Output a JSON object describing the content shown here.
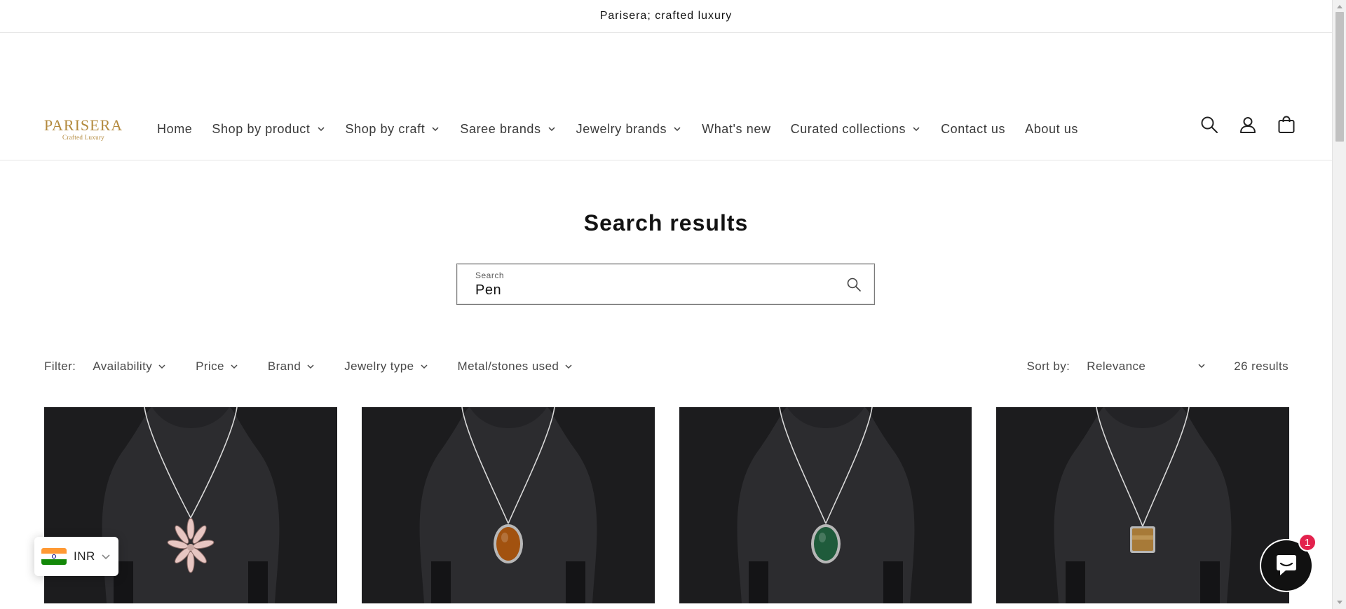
{
  "announcement": {
    "text": "Parisera; crafted luxury"
  },
  "logo": {
    "main": "PARISERA",
    "sub": "Crafted Luxury"
  },
  "nav": {
    "items": [
      {
        "label": "Home",
        "dropdown": false
      },
      {
        "label": "Shop by product",
        "dropdown": true
      },
      {
        "label": "Shop by craft",
        "dropdown": true
      },
      {
        "label": "Saree brands",
        "dropdown": true
      },
      {
        "label": "Jewelry brands",
        "dropdown": true
      },
      {
        "label": "What's new",
        "dropdown": false
      },
      {
        "label": "Curated collections",
        "dropdown": true
      },
      {
        "label": "Contact us",
        "dropdown": false
      },
      {
        "label": "About us",
        "dropdown": false
      }
    ]
  },
  "header_icons": [
    "search-icon",
    "account-icon",
    "cart-icon"
  ],
  "page": {
    "title": "Search results"
  },
  "search": {
    "label": "Search",
    "value": "Pen"
  },
  "filters": {
    "label": "Filter:",
    "facets": [
      "Availability",
      "Price",
      "Brand",
      "Jewelry type",
      "Metal/stones used"
    ]
  },
  "sort": {
    "label": "Sort by:",
    "value": "Relevance"
  },
  "results": {
    "count_text": "26 results"
  },
  "products": [
    {
      "image": "cross-pendant-necklace",
      "pendant_color": "#e7c6c2"
    },
    {
      "image": "amber-oval-pendant-necklace",
      "pendant_color": "#a2520f"
    },
    {
      "image": "green-oval-pendant-necklace",
      "pendant_color": "#1f5b3b"
    },
    {
      "image": "tigers-eye-square-pendant-necklace",
      "pendant_color": "#a77a38"
    }
  ],
  "currency": {
    "code": "INR",
    "flag": "india-flag-icon"
  },
  "chat": {
    "badge": "1"
  },
  "colors": {
    "brand": "#b38a3e",
    "badge": "#e3224d",
    "product_bg": "#1d1d1f"
  }
}
